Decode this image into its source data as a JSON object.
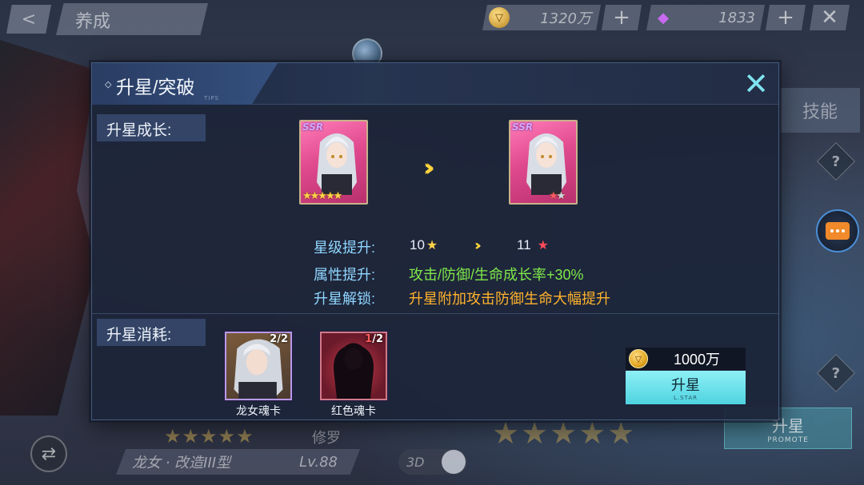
{
  "screen": {
    "title": "养成",
    "gold_value": "1320万",
    "gem_value": "1833",
    "plus_label": "+",
    "close_label": "✕"
  },
  "background": {
    "skill_label": "技能",
    "help_label": "?",
    "promote_label": "升星",
    "promote_sub": "PROMOTE",
    "character_stars": "★★★★★",
    "character_name": "龙女 · 改造III型",
    "character_level": "Lv.88",
    "side_tag": "修罗",
    "toggle_label": "3D",
    "refresh_icon": "refresh-icon",
    "chat_icon": "chat-icon"
  },
  "modal": {
    "title": "升星/突破",
    "tips_tag": "TIPS",
    "close_icon": "close-icon",
    "growth_label": "升星成长:",
    "cost_label": "升星消耗:",
    "card_before": {
      "rarity": "SSR",
      "stars": "★★★★★"
    },
    "card_after": {
      "rarity": "SSR"
    },
    "info": {
      "star_level_key": "星级提升:",
      "star_from": "10",
      "star_to": "11",
      "attr_key": "属性提升:",
      "attr_value": "攻击/防御/生命成长率+30%",
      "unlock_key": "升星解锁:",
      "unlock_value": "升星附加攻击防御生命大幅提升"
    },
    "costs": [
      {
        "name": "龙女魂卡",
        "have": "2",
        "need": "2"
      },
      {
        "name": "红色魂卡",
        "have": "1",
        "need": "2"
      }
    ],
    "price": "1000万",
    "confirm_label": "升星",
    "confirm_sub": "L.STAR"
  },
  "colors": {
    "accent_cyan": "#7fe3ef",
    "key_blue": "#8fd6ff",
    "value_green": "#7ee84a",
    "value_orange": "#ffb22c",
    "arrow_yellow": "#ffd43b"
  }
}
